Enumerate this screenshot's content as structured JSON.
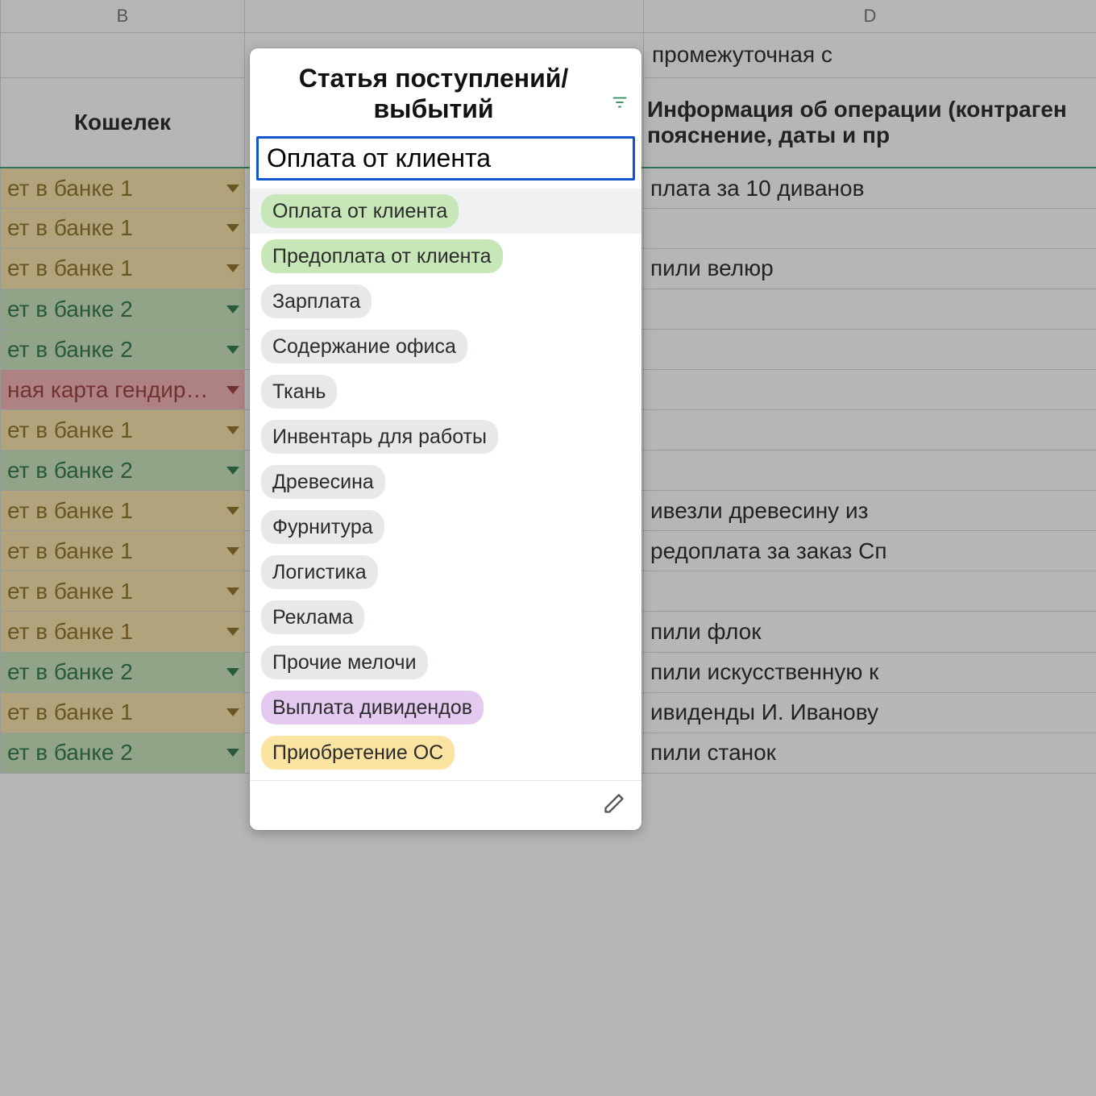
{
  "columns": {
    "b_letter": "B",
    "d_letter": "D"
  },
  "headers": {
    "b_row2": "",
    "b_row3": "Кошелек",
    "c_row23": "Статья поступлений/выбытий",
    "d_row2": "промежуточная с",
    "d_row3": "Информация об операции (контраген пояснение, даты и пр"
  },
  "rows": [
    {
      "wallet": "ет в банке 1",
      "wcolor": "yellow",
      "info": "плата за 10 диванов"
    },
    {
      "wallet": "ет в банке 1",
      "wcolor": "yellow",
      "info": ""
    },
    {
      "wallet": "ет в банке 1",
      "wcolor": "yellow",
      "info": "пили велюр"
    },
    {
      "wallet": "ет в банке 2",
      "wcolor": "green",
      "info": ""
    },
    {
      "wallet": "ет в банке 2",
      "wcolor": "green",
      "info": ""
    },
    {
      "wallet": "ная карта гендир…",
      "wcolor": "red",
      "info": ""
    },
    {
      "wallet": "ет в банке 1",
      "wcolor": "yellow",
      "info": ""
    },
    {
      "wallet": "ет в банке 2",
      "wcolor": "green",
      "info": ""
    },
    {
      "wallet": "ет в банке 1",
      "wcolor": "yellow",
      "info": "ивезли древесину из"
    },
    {
      "wallet": "ет в банке 1",
      "wcolor": "yellow",
      "info": "редоплата за заказ Сп"
    },
    {
      "wallet": "ет в банке 1",
      "wcolor": "yellow",
      "info": ""
    },
    {
      "wallet": "ет в банке 1",
      "wcolor": "yellow",
      "info": "пили флок"
    },
    {
      "wallet": "ет в банке 2",
      "wcolor": "green",
      "info": "пили искусственную к"
    },
    {
      "wallet": "ет в банке 1",
      "wcolor": "yellow",
      "info": "ивиденды И. Иванову"
    },
    {
      "wallet": "ет в банке 2",
      "wcolor": "green",
      "info": "пили станок"
    }
  ],
  "popup": {
    "title": "Статья поступлений/выбытий",
    "input_value": "Оплата от клиента",
    "selected_index": 0,
    "options": [
      {
        "label": "Оплата от клиента",
        "color": "green"
      },
      {
        "label": "Предоплата от клиента",
        "color": "green"
      },
      {
        "label": "Зарплата",
        "color": "gray"
      },
      {
        "label": "Содержание офиса",
        "color": "gray"
      },
      {
        "label": "Ткань",
        "color": "gray"
      },
      {
        "label": "Инвентарь для работы",
        "color": "gray"
      },
      {
        "label": "Древесина",
        "color": "gray"
      },
      {
        "label": "Фурнитура",
        "color": "gray"
      },
      {
        "label": "Логистика",
        "color": "gray"
      },
      {
        "label": "Реклама",
        "color": "gray"
      },
      {
        "label": "Прочие мелочи",
        "color": "gray"
      },
      {
        "label": "Выплата дивидендов",
        "color": "purple"
      },
      {
        "label": "Приобретение ОС",
        "color": "yellow"
      }
    ]
  }
}
